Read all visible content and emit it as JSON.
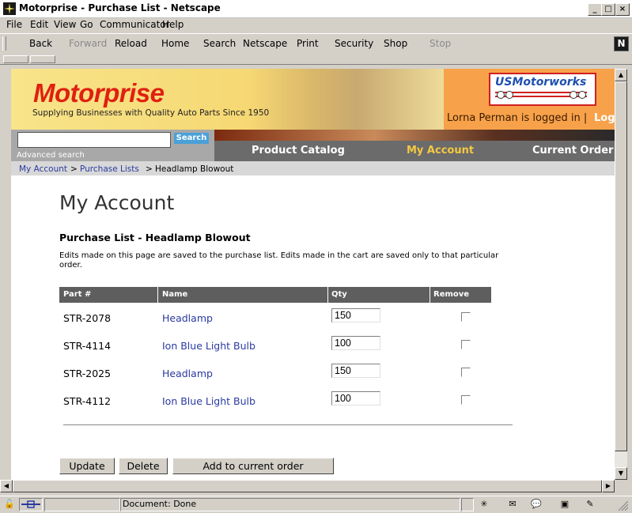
{
  "window": {
    "title": "Motorprise - Purchase List - Netscape",
    "controls": [
      "_",
      "□",
      "×"
    ]
  },
  "menu": [
    "File",
    "Edit",
    "View",
    "Go",
    "Communicator",
    "Help"
  ],
  "toolbar": {
    "back": "Back",
    "forward": "Forward",
    "reload": "Reload",
    "home": "Home",
    "search": "Search",
    "netscape": "Netscape",
    "print": "Print",
    "security": "Security",
    "shop": "Shop",
    "stop": "Stop",
    "logo": "N"
  },
  "site": {
    "logo": "Motorprise",
    "tagline": "Supplying Businesses with Quality Auto Parts Since 1950",
    "partner_logo": "USMotorworks",
    "logged_in": "Lorna Perman is logged in |",
    "logout": "Log",
    "search_button": "Search",
    "search_value": "",
    "advanced_search": "Advanced search",
    "nav": {
      "catalog": "Product Catalog",
      "account": "My Account",
      "order": "Current Order"
    },
    "breadcrumb": {
      "a": "My Account",
      "sep1": ">",
      "b": "Purchase Lists",
      "sep2": ">",
      "c": "Headlamp Blowout"
    }
  },
  "page": {
    "title": "My Account",
    "list_title": "Purchase List - Headlamp Blowout",
    "note": "Edits made on this page are saved to the purchase list. Edits made in the cart are saved only to that particular order.",
    "columns": {
      "part": "Part #",
      "name": "Name",
      "qty": "Qty",
      "remove": "Remove"
    },
    "rows": [
      {
        "part": "STR-2078",
        "name": "Headlamp",
        "qty": "150"
      },
      {
        "part": "STR-4114",
        "name": "Ion Blue Light Bulb",
        "qty": "100"
      },
      {
        "part": "STR-2025",
        "name": "Headlamp",
        "qty": "150"
      },
      {
        "part": "STR-4112",
        "name": "Ion Blue Light Bulb",
        "qty": "100"
      }
    ],
    "buttons": {
      "update": "Update",
      "delete": "Delete",
      "add": "Add to current order"
    }
  },
  "status": {
    "text": "Document: Done"
  }
}
